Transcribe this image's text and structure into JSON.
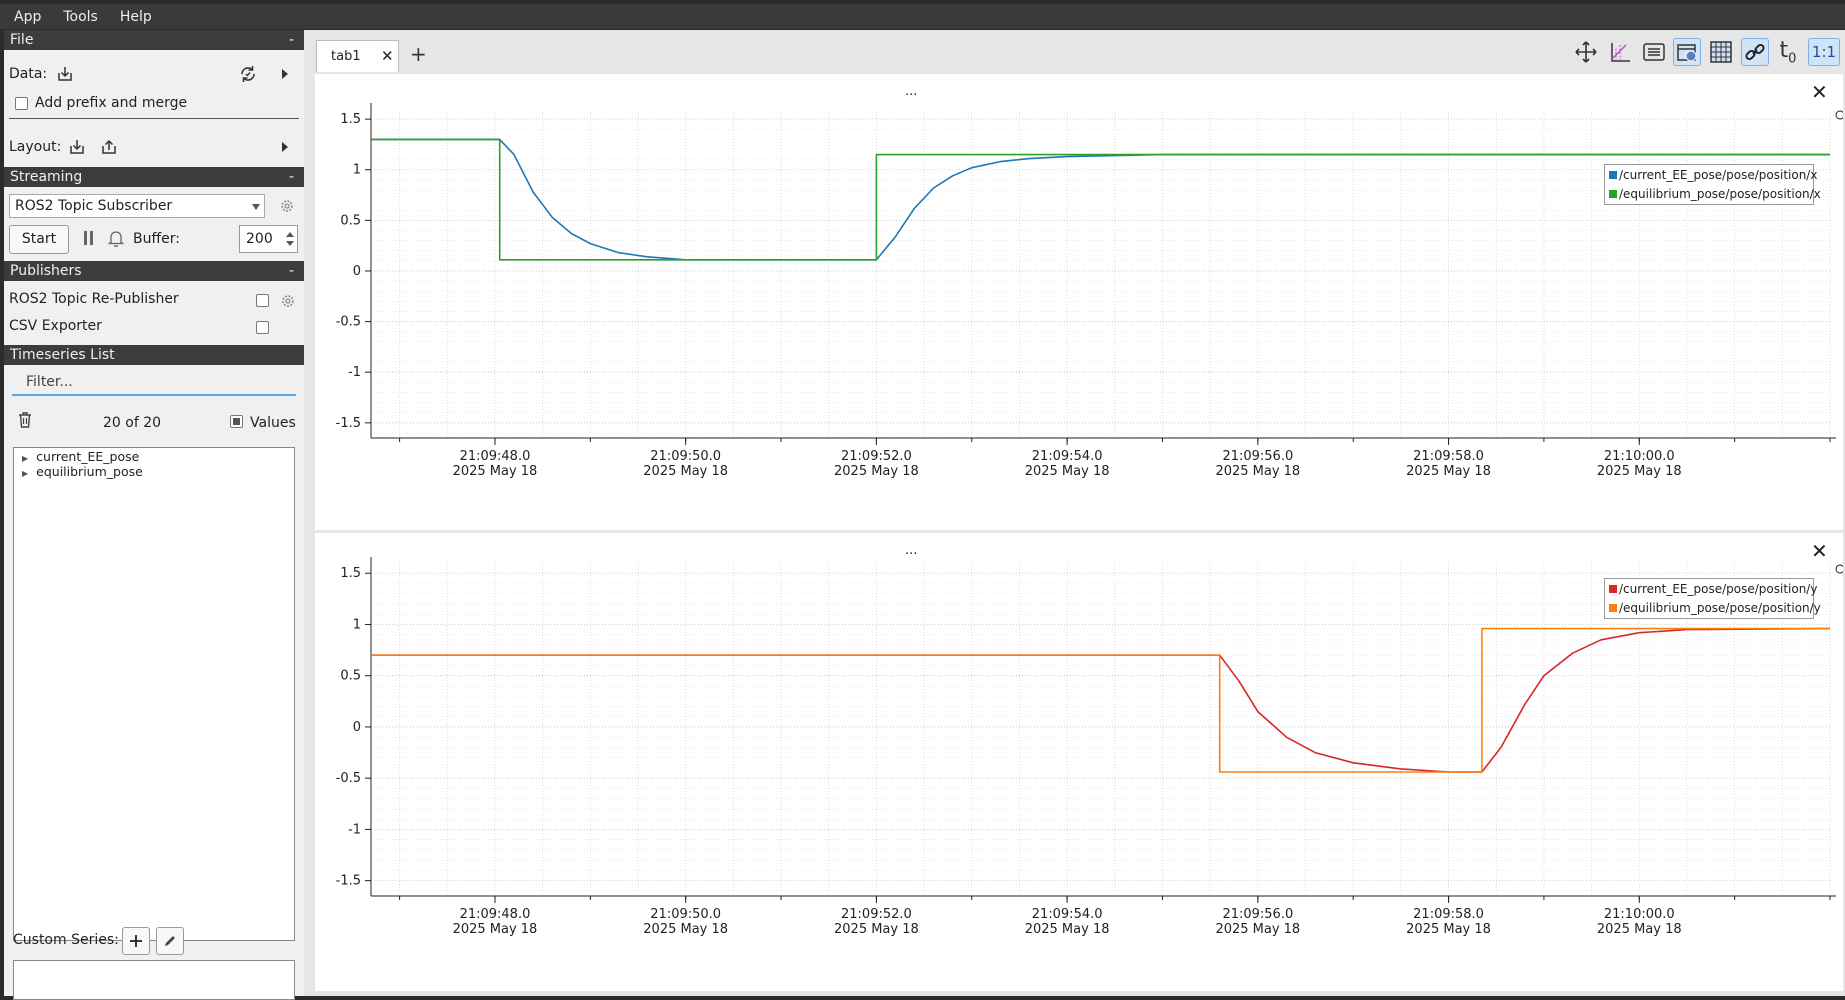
{
  "menubar": {
    "items": [
      "App",
      "Tools",
      "Help"
    ]
  },
  "sidebar": {
    "file": {
      "title": "File",
      "collapse": "-",
      "data_label": "Data:",
      "prefix_label": "Add prefix and merge",
      "layout_label": "Layout:"
    },
    "streaming": {
      "title": "Streaming",
      "collapse": "-",
      "source": "ROS2 Topic Subscriber",
      "start_label": "Start",
      "buffer_label": "Buffer:",
      "buffer_value": "200"
    },
    "publishers": {
      "title": "Publishers",
      "collapse": "-",
      "items": [
        "ROS2 Topic Re-Publisher",
        "CSV Exporter"
      ]
    },
    "timeseries": {
      "title": "Timeseries List",
      "filter_placeholder": "Filter...",
      "count": "20 of 20",
      "values_label": "Values",
      "items": [
        "current_EE_pose",
        "equilibrium_pose"
      ]
    },
    "custom_series_label": "Custom Series:"
  },
  "tabs": [
    {
      "label": "tab1"
    }
  ],
  "toolbar": {
    "icons": [
      "move-icon",
      "axis-ratio-icon",
      "legend-icon",
      "time-window-icon",
      "grid-icon",
      "link-icon",
      "t0-icon",
      "ratio-1-1-icon"
    ],
    "t0_label": "t",
    "t0_sub": "0",
    "ratio_label": "1:1"
  },
  "plots": [
    {
      "title": "...",
      "legend": [
        {
          "name": "/current_EE_pose/pose/position/x",
          "color": "#1f77b4"
        },
        {
          "name": "/equilibrium_pose/pose/position/x",
          "color": "#2ca02c"
        }
      ]
    },
    {
      "title": "...",
      "legend": [
        {
          "name": "/current_EE_pose/pose/position/y",
          "color": "#d62728"
        },
        {
          "name": "/equilibrium_pose/pose/position/y",
          "color": "#ff7f0e"
        }
      ]
    }
  ],
  "chart_data": [
    {
      "type": "line",
      "title": "",
      "xlabel": "",
      "ylabel": "",
      "xlim": [
        46.7,
        62.0
      ],
      "ylim": [
        -1.65,
        1.6
      ],
      "grid": true,
      "legend": "top-right",
      "y_ticks": [
        1.5,
        1,
        0.5,
        0,
        -0.5,
        -1,
        -1.5
      ],
      "y_tick_labels": [
        "1.5",
        "1",
        "0.5",
        "0",
        "-0.5",
        "-1",
        "-1.5"
      ],
      "x_ticks": [
        48,
        50,
        52,
        54,
        56,
        58,
        60
      ],
      "x_tick_labels": [
        [
          "21:09:48.0",
          "2025 May 18"
        ],
        [
          "21:09:50.0",
          "2025 May 18"
        ],
        [
          "21:09:52.0",
          "2025 May 18"
        ],
        [
          "21:09:54.0",
          "2025 May 18"
        ],
        [
          "21:09:56.0",
          "2025 May 18"
        ],
        [
          "21:09:58.0",
          "2025 May 18"
        ],
        [
          "21:10:00.0",
          "2025 May 18"
        ]
      ],
      "series": [
        {
          "name": "/current_EE_pose/pose/position/x",
          "color": "#1f77b4",
          "x": [
            46.7,
            48.05,
            48.2,
            48.4,
            48.6,
            48.8,
            49.0,
            49.3,
            49.6,
            50.0,
            52.0,
            52.2,
            52.4,
            52.6,
            52.8,
            53.0,
            53.3,
            53.6,
            54.0,
            54.5,
            55.0,
            62.0
          ],
          "y": [
            1.3,
            1.3,
            1.15,
            0.78,
            0.53,
            0.37,
            0.27,
            0.18,
            0.14,
            0.11,
            0.11,
            0.34,
            0.62,
            0.82,
            0.94,
            1.02,
            1.08,
            1.11,
            1.13,
            1.14,
            1.15,
            1.15
          ]
        },
        {
          "name": "/equilibrium_pose/pose/position/x",
          "color": "#2ca02c",
          "x": [
            46.7,
            48.05,
            48.05,
            52.0,
            52.0,
            62.0
          ],
          "y": [
            1.3,
            1.3,
            0.11,
            0.11,
            1.15,
            1.15
          ]
        }
      ]
    },
    {
      "type": "line",
      "title": "",
      "xlabel": "",
      "ylabel": "",
      "xlim": [
        46.7,
        62.0
      ],
      "ylim": [
        -1.65,
        1.6
      ],
      "grid": true,
      "legend": "top-right",
      "y_ticks": [
        1.5,
        1,
        0.5,
        0,
        -0.5,
        -1,
        -1.5
      ],
      "y_tick_labels": [
        "1.5",
        "1",
        "0.5",
        "0",
        "-0.5",
        "-1",
        "-1.5"
      ],
      "x_ticks": [
        48,
        50,
        52,
        54,
        56,
        58,
        60
      ],
      "x_tick_labels": [
        [
          "21:09:48.0",
          "2025 May 18"
        ],
        [
          "21:09:50.0",
          "2025 May 18"
        ],
        [
          "21:09:52.0",
          "2025 May 18"
        ],
        [
          "21:09:54.0",
          "2025 May 18"
        ],
        [
          "21:09:56.0",
          "2025 May 18"
        ],
        [
          "21:09:58.0",
          "2025 May 18"
        ],
        [
          "21:10:00.0",
          "2025 May 18"
        ]
      ],
      "series": [
        {
          "name": "/current_EE_pose/pose/position/y",
          "color": "#d62728",
          "x": [
            46.7,
            55.6,
            55.8,
            56.0,
            56.3,
            56.6,
            57.0,
            57.5,
            58.0,
            58.35,
            58.55,
            58.8,
            59.0,
            59.3,
            59.6,
            60.0,
            60.5,
            62.0
          ],
          "y": [
            0.7,
            0.7,
            0.45,
            0.15,
            -0.1,
            -0.25,
            -0.35,
            -0.41,
            -0.44,
            -0.44,
            -0.2,
            0.22,
            0.5,
            0.72,
            0.85,
            0.92,
            0.95,
            0.96
          ]
        },
        {
          "name": "/equilibrium_pose/pose/position/y",
          "color": "#ff7f0e",
          "x": [
            46.7,
            55.6,
            55.6,
            58.35,
            58.35,
            62.0
          ],
          "y": [
            0.7,
            0.7,
            -0.44,
            -0.44,
            0.96,
            0.96
          ]
        }
      ]
    }
  ]
}
